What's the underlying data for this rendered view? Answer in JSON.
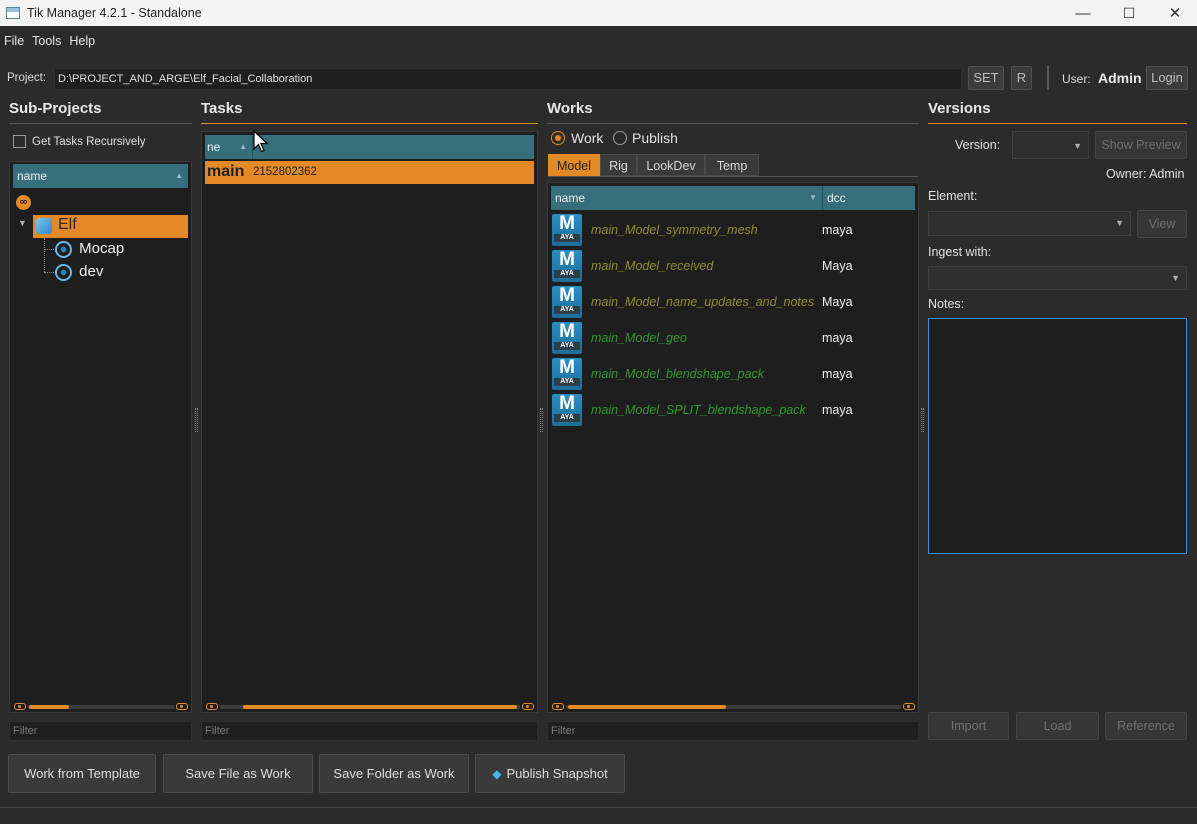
{
  "window": {
    "title": "Tik Manager 4.2.1 - Standalone",
    "minimize": "—",
    "maximize": "☐",
    "close": "✕"
  },
  "menu": [
    "File",
    "Tools",
    "Help"
  ],
  "project": {
    "label": "Project:",
    "path": "D:\\PROJECT_AND_ARGE\\Elf_Facial_Collaboration",
    "set_label": "SET",
    "r_label": "R",
    "user_label": "User:",
    "user_name": "Admin",
    "login_label": "Login"
  },
  "subprojects": {
    "title": "Sub-Projects",
    "recursive_label": "Get Tasks Recursively",
    "header": "name",
    "root_icon": "∞",
    "tree": [
      {
        "label": "Elf",
        "selected": true
      },
      {
        "label": "Mocap"
      },
      {
        "label": "dev"
      }
    ],
    "filter_placeholder": "Filter"
  },
  "tasks": {
    "title": "Tasks",
    "header_col1": "ne",
    "header_col2": "",
    "rows": [
      {
        "name": "main",
        "id": "2152802362"
      }
    ],
    "filter_placeholder": "Filter"
  },
  "works": {
    "title": "Works",
    "radio_work": "Work",
    "radio_publish": "Publish",
    "tabs": [
      "Model",
      "Rig",
      "LookDev",
      "Temp"
    ],
    "header_name": "name",
    "header_dcc": "dcc",
    "icon_letter": "M",
    "icon_sub": "AYA",
    "rows": [
      {
        "name": "main_Model_symmetry_mesh",
        "dcc": "maya",
        "color": "#8f8f2a"
      },
      {
        "name": "main_Model_received",
        "dcc": "Maya",
        "color": "#8f8f2a"
      },
      {
        "name": "main_Model_name_updates_and_notes",
        "dcc": "Maya",
        "color": "#8f8f2a"
      },
      {
        "name": "main_Model_geo",
        "dcc": "maya",
        "color": "#2e9a2e"
      },
      {
        "name": "main_Model_blendshape_pack",
        "dcc": "maya",
        "color": "#2e9a2e"
      },
      {
        "name": "main_Model_SPLIT_blendshape_pack",
        "dcc": "maya",
        "color": "#2e9a2e"
      }
    ],
    "filter_placeholder": "Filter"
  },
  "versions": {
    "title": "Versions",
    "version_label": "Version:",
    "show_preview": "Show Preview",
    "owner": "Owner: Admin",
    "element_label": "Element:",
    "view_label": "View",
    "ingest_label": "Ingest with:",
    "notes_label": "Notes:",
    "import_label": "Import",
    "load_label": "Load",
    "reference_label": "Reference"
  },
  "bottom": {
    "work_from_template": "Work from Template",
    "save_file": "Save File as Work",
    "save_folder": "Save Folder as Work",
    "publish_snapshot": "Publish Snapshot",
    "publish_icon": "◆"
  },
  "colors": {
    "accent": "#e38a26",
    "header": "#366e7b",
    "publish_icon": "#45b6e8"
  }
}
